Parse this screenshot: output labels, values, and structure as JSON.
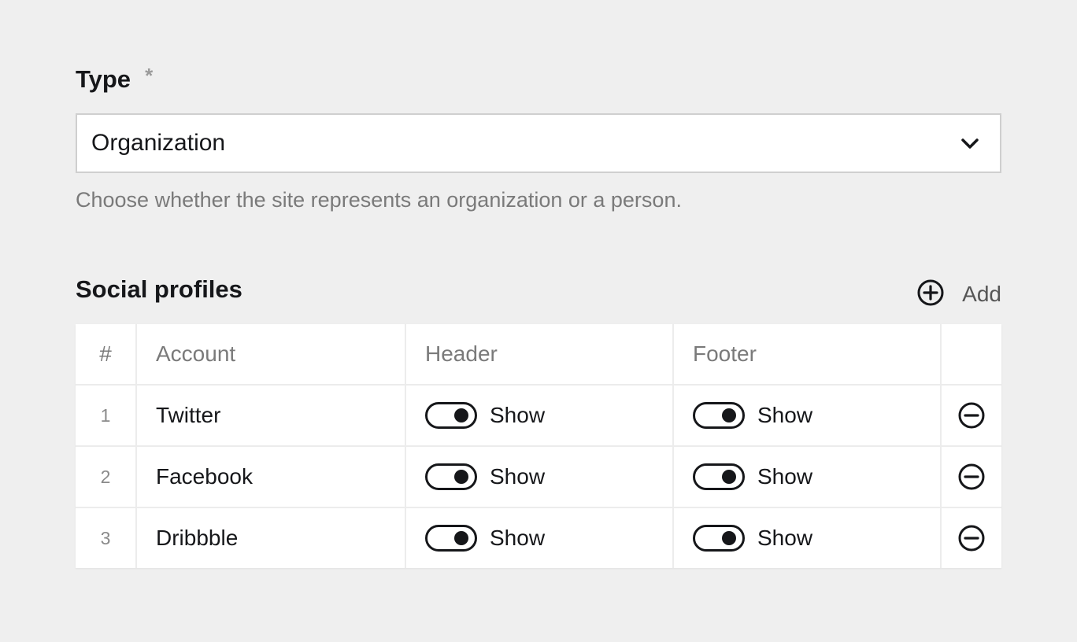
{
  "type_field": {
    "label": "Type",
    "required_marker": "*",
    "selected_value": "Organization",
    "help_text": "Choose whether the site represents an organization or a person."
  },
  "social_profiles": {
    "title": "Social profiles",
    "add_label": "Add",
    "columns": [
      "#",
      "Account",
      "Header",
      "Footer"
    ],
    "rows": [
      {
        "num": "1",
        "account": "Twitter",
        "header": "Show",
        "footer": "Show",
        "header_on": true,
        "footer_on": true
      },
      {
        "num": "2",
        "account": "Facebook",
        "header": "Show",
        "footer": "Show",
        "header_on": true,
        "footer_on": true
      },
      {
        "num": "3",
        "account": "Dribbble",
        "header": "Show",
        "footer": "Show",
        "header_on": true,
        "footer_on": true
      }
    ]
  },
  "icons": {
    "select": "chevron-down-icon",
    "add": "plus-circle-icon",
    "remove": "minus-circle-icon"
  },
  "colors": {
    "background": "#efefef",
    "text": "#16171a",
    "muted": "#7a7a7a",
    "border": "#cfcfcf"
  }
}
